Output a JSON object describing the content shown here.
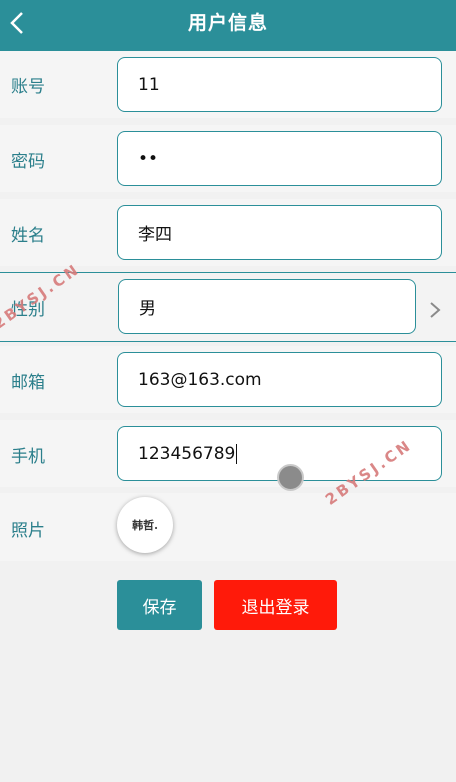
{
  "header": {
    "title": "用户信息",
    "back_icon": "chevron-left-icon"
  },
  "form": {
    "account": {
      "label": "账号",
      "value": "11"
    },
    "password": {
      "label": "密码",
      "value": "••"
    },
    "name": {
      "label": "姓名",
      "value": "李四"
    },
    "gender": {
      "label": "性别",
      "value": "男"
    },
    "email": {
      "label": "邮箱",
      "value": "163@163.com"
    },
    "phone": {
      "label": "手机",
      "value": "123456789"
    },
    "photo": {
      "label": "照片",
      "avatar_text": "韩哲."
    }
  },
  "actions": {
    "save_label": "保存",
    "logout_label": "退出登录"
  },
  "watermarks": [
    "2BYSJ.CN",
    "2BYSJ.CN"
  ],
  "colors": {
    "primary": "#2b8f99",
    "danger": "#ff1a0a",
    "watermark": "#d77b7b"
  }
}
